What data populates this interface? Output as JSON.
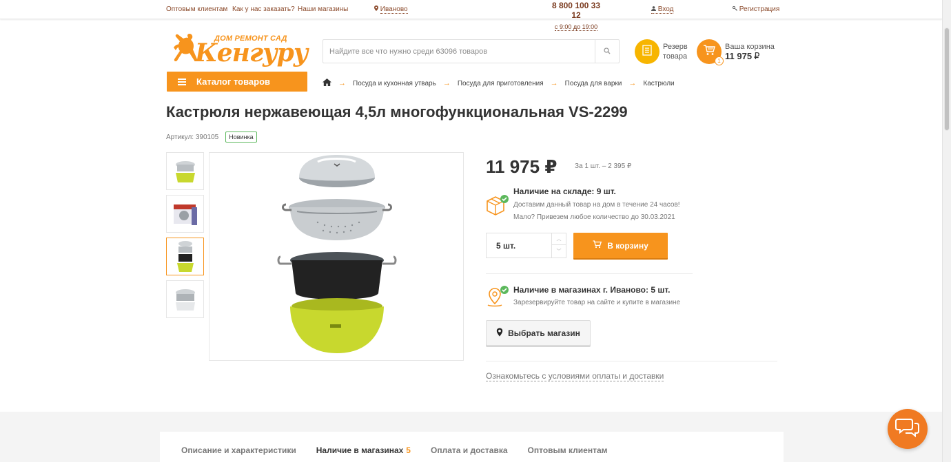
{
  "topbar": {
    "wholesale": "Оптовым клиентам",
    "how_to_order": "Как у нас заказать?",
    "our_stores": "Наши магазины",
    "city": "Иваново",
    "phone": "8 800 100 33 12",
    "hours": "с 9:00 до 19:00",
    "login": "Вход",
    "register": "Регистрация"
  },
  "logo": {
    "tagline": "ДОМ РЕМОНТ САД",
    "brand": "Кенгуру"
  },
  "search": {
    "placeholder": "Найдите все что нужно среди 63096 товаров"
  },
  "header": {
    "reserve_line1": "Резерв",
    "reserve_line2": "товара",
    "cart_label": "Ваша корзина",
    "cart_sum": "11 975",
    "cart_currency": "₽",
    "cart_count": "1"
  },
  "catalog": {
    "label": "Каталог товаров"
  },
  "breadcrumbs": [
    "Посуда и кухонная утварь",
    "Посуда для приготовления",
    "Посуда для варки",
    "Кастрюли"
  ],
  "product": {
    "title": "Кастрюля нержавеющая 4,5л многофункциональная VS-2299",
    "article": "Артикул: 390105",
    "badge": "Новинка",
    "price": "11 975 ₽",
    "unit_price": "За 1 шт. – 2 395 ₽",
    "stock_head": "Наличие на складе: 9 шт.",
    "stock_line1": "Доставим данный товар на дом в течение 24 часов!",
    "stock_line2": "Мало? Привезем любое количество до 30.03.2021",
    "qty_value": "5 шт.",
    "to_cart": "В корзину",
    "shops_head": "Наличие в магазинах г. Иваново: 5 шт.",
    "shops_line": "Зарезервируйте товар на сайте и купите в магазине",
    "choose_shop": "Выбрать магазин",
    "terms": "Ознакомьтесь с условиями оплаты и доставки"
  },
  "tabs": [
    {
      "label": "Описание и характеристики",
      "count": ""
    },
    {
      "label": "Наличие в магазинах",
      "count": "5"
    },
    {
      "label": "Оплата и доставка",
      "count": ""
    },
    {
      "label": "Оптовым клиентам",
      "count": ""
    }
  ],
  "colors": {
    "accent": "#f7941d",
    "link_brown": "#8b4a2b",
    "success": "#5cb85c",
    "pot_lime": "#c8d82e"
  }
}
